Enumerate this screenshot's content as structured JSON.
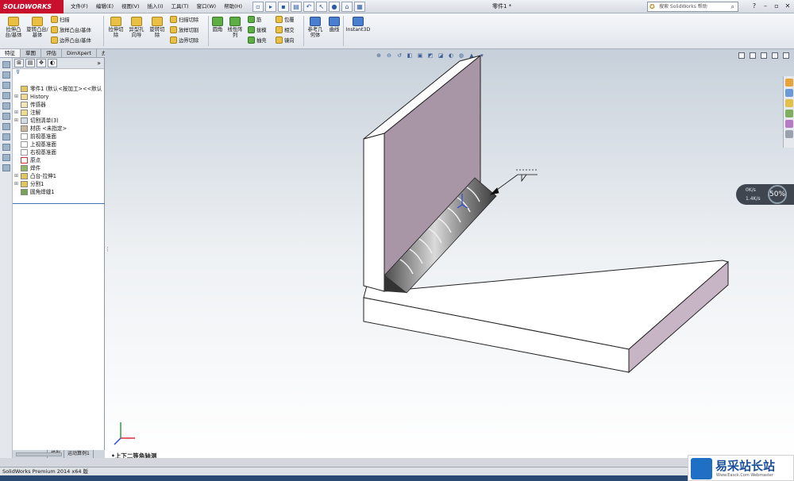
{
  "app": {
    "brand": "SOLIDWORKS",
    "doc_title": "零件1 *"
  },
  "menus": [
    "文件(F)",
    "编辑(E)",
    "视图(V)",
    "插入(I)",
    "工具(T)",
    "窗口(W)",
    "帮助(H)"
  ],
  "search": {
    "placeholder": "搜索 SolidWorks 帮助"
  },
  "ribbon": {
    "extrude_boss": "拉伸凸台/基体",
    "revolve_boss": "旋转凸台/基体",
    "sweep": "扫描",
    "loft_boss": "放样凸台/基体",
    "boundary_boss": "边界凸台/基体",
    "extrude_cut": "拉伸切除",
    "hole_wizard": "异型孔向导",
    "revolve_cut": "旋转切除",
    "swept_cut": "扫描切除",
    "lofted_cut": "放样切割",
    "boundary_cut": "边界切除",
    "fillet": "圆角",
    "linear_pattern": "线性阵列",
    "rib": "筋",
    "draft": "拔模",
    "shell": "抽壳",
    "wrap": "包覆",
    "intersect": "相交",
    "mirror": "镜向",
    "ref_geometry": "参考几何体",
    "curves": "曲线",
    "instant3d": "Instant3D"
  },
  "tabs": [
    "特征",
    "草图",
    "评估",
    "DimXpert",
    "办公室产品"
  ],
  "tree": [
    "零件1 (默认<按加工><<默认",
    "History",
    "传感器",
    "注解",
    "切割清单(3)",
    "材质 <未指定>",
    "前视基准面",
    "上视基准面",
    "右视基准面",
    "原点",
    "焊件",
    "凸台-拉伸1",
    "分割1",
    "圆角焊缝1"
  ],
  "fm_bottom_tabs": [
    "模型",
    "运动算例1"
  ],
  "perf": {
    "line1": "0K/s",
    "line2": "1.4K/s",
    "percent": "50%"
  },
  "view_label": "•上下二等角轴测",
  "status": "SolidWorks Premium 2014 x64 版",
  "watermark": {
    "title": "易采站长站",
    "sub": "Www.Easck.Com Webmaster"
  },
  "colors": {
    "brand_red": "#c8102e",
    "panel_purple": "#a895a6",
    "tree_accent": "#4470b4"
  }
}
